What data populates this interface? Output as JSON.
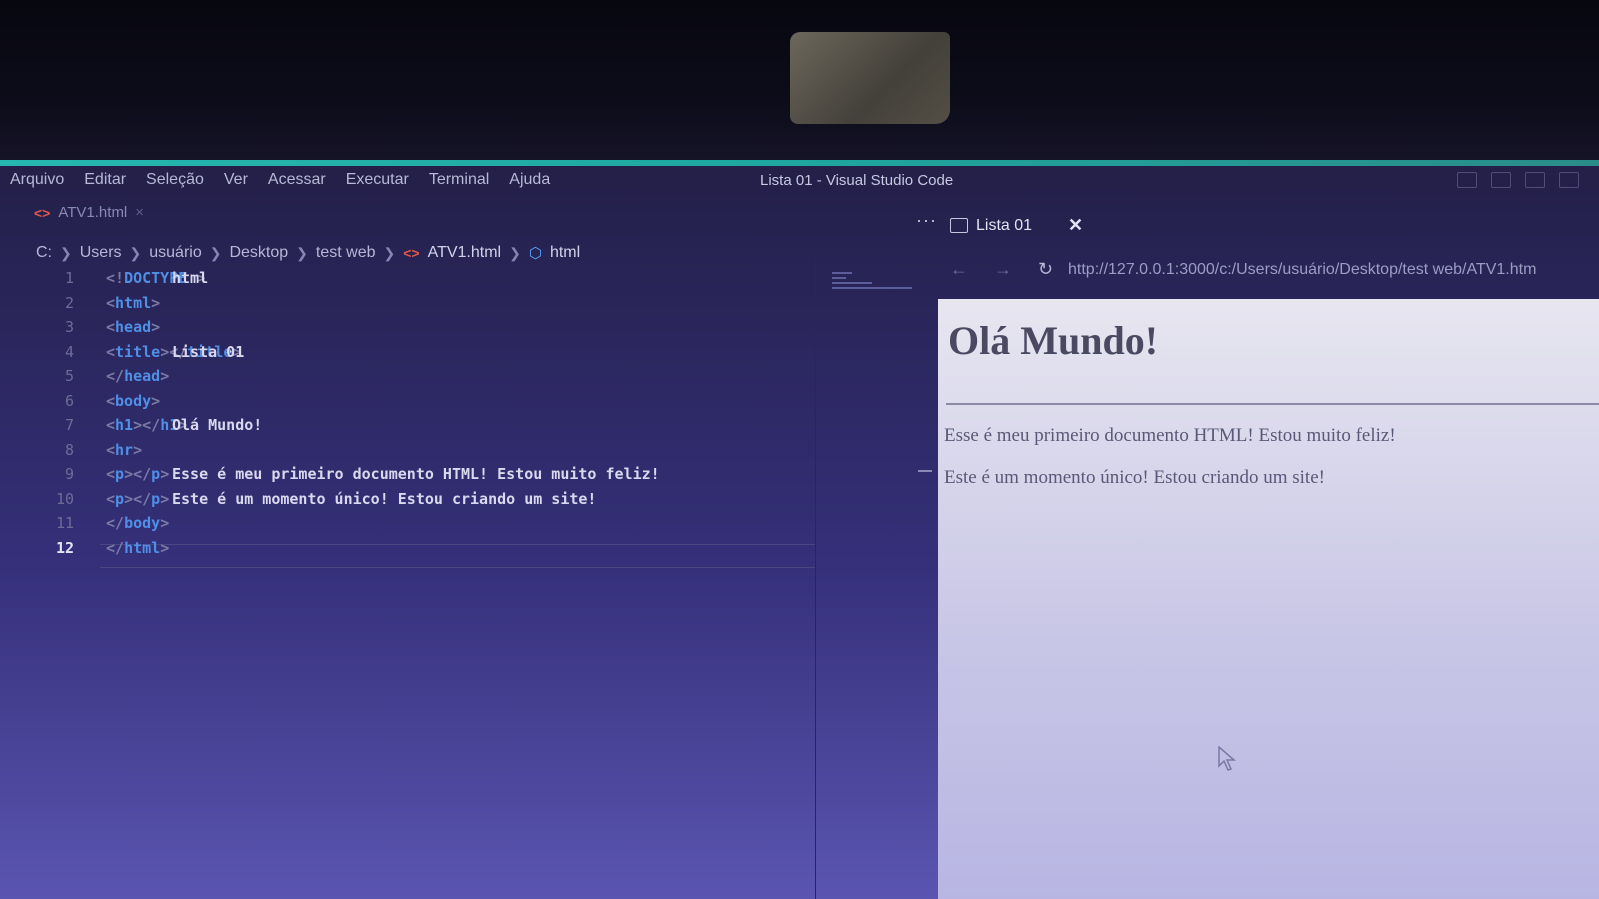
{
  "menubar": {
    "items": [
      "Arquivo",
      "Editar",
      "Seleção",
      "Ver",
      "Acessar",
      "Executar",
      "Terminal",
      "Ajuda"
    ],
    "window_title": "Lista 01 - Visual Studio Code"
  },
  "editor": {
    "tab_label": "ATV1.html",
    "breadcrumb": [
      "C:",
      "Users",
      "usuário",
      "Desktop",
      "test web",
      "ATV1.html",
      "html"
    ],
    "lines": [
      {
        "num": "1",
        "parts": [
          [
            "br",
            "<!"
          ],
          [
            "kw",
            "DOCTYPE "
          ],
          [
            "txt",
            "html"
          ],
          [
            "br",
            ">"
          ]
        ]
      },
      {
        "num": "2",
        "parts": [
          [
            "br",
            "<"
          ],
          [
            "tag",
            "html"
          ],
          [
            "br",
            ">"
          ]
        ]
      },
      {
        "num": "3",
        "parts": [
          [
            "txt",
            "    "
          ],
          [
            "br",
            "<"
          ],
          [
            "tag",
            "head"
          ],
          [
            "br",
            ">"
          ]
        ]
      },
      {
        "num": "4",
        "parts": [
          [
            "txt",
            "        "
          ],
          [
            "br",
            "<"
          ],
          [
            "tag",
            "title"
          ],
          [
            "br",
            ">"
          ],
          [
            "txt",
            "Lista 01"
          ],
          [
            "br",
            "</"
          ],
          [
            "tag",
            "title"
          ],
          [
            "br",
            ">"
          ]
        ]
      },
      {
        "num": "5",
        "parts": [
          [
            "txt",
            "    "
          ],
          [
            "br",
            "</"
          ],
          [
            "tag",
            "head"
          ],
          [
            "br",
            ">"
          ]
        ]
      },
      {
        "num": "6",
        "parts": [
          [
            "txt",
            "    "
          ],
          [
            "br",
            "<"
          ],
          [
            "tag",
            "body"
          ],
          [
            "br",
            ">"
          ]
        ]
      },
      {
        "num": "7",
        "parts": [
          [
            "txt",
            "        "
          ],
          [
            "br",
            "<"
          ],
          [
            "tag",
            "h1"
          ],
          [
            "br",
            ">"
          ],
          [
            "txt",
            "Olá Mundo!"
          ],
          [
            "br",
            "</"
          ],
          [
            "tag",
            "h1"
          ],
          [
            "br",
            ">"
          ]
        ]
      },
      {
        "num": "8",
        "parts": [
          [
            "txt",
            "        "
          ],
          [
            "br",
            "<"
          ],
          [
            "tag",
            "hr"
          ],
          [
            "br",
            ">"
          ]
        ]
      },
      {
        "num": "9",
        "parts": [
          [
            "txt",
            "        "
          ],
          [
            "br",
            "<"
          ],
          [
            "tag",
            "p"
          ],
          [
            "br",
            ">"
          ],
          [
            "txt",
            "Esse é meu primeiro documento HTML! Estou muito feliz!"
          ],
          [
            "br",
            "</"
          ],
          [
            "tag",
            "p"
          ],
          [
            "br",
            ">"
          ]
        ]
      },
      {
        "num": "10",
        "parts": [
          [
            "txt",
            "        "
          ],
          [
            "br",
            "<"
          ],
          [
            "tag",
            "p"
          ],
          [
            "br",
            ">"
          ],
          [
            "txt",
            "Este é um momento único! Estou criando um site!"
          ],
          [
            "br",
            "</"
          ],
          [
            "tag",
            "p"
          ],
          [
            "br",
            ">"
          ]
        ]
      },
      {
        "num": "11",
        "parts": [
          [
            "txt",
            "    "
          ],
          [
            "br",
            "</"
          ],
          [
            "tag",
            "body"
          ],
          [
            "br",
            ">"
          ]
        ]
      },
      {
        "num": "12",
        "parts": [
          [
            "br",
            "</"
          ],
          [
            "tag",
            "html"
          ],
          [
            "br",
            ">"
          ]
        ]
      }
    ],
    "current_line": "12"
  },
  "preview": {
    "tab_label": "Lista 01",
    "url": "http://127.0.0.1:3000/c:/Users/usuário/Desktop/test web/ATV1.htm",
    "heading": "Olá Mundo!",
    "paragraphs": [
      "Esse é meu primeiro documento HTML! Estou muito feliz!",
      "Este é um momento único! Estou criando um site!"
    ]
  },
  "colors": {
    "accent_line": "#26b7b0",
    "tag": "#4f8fe6",
    "file_icon": "#e0584b"
  }
}
